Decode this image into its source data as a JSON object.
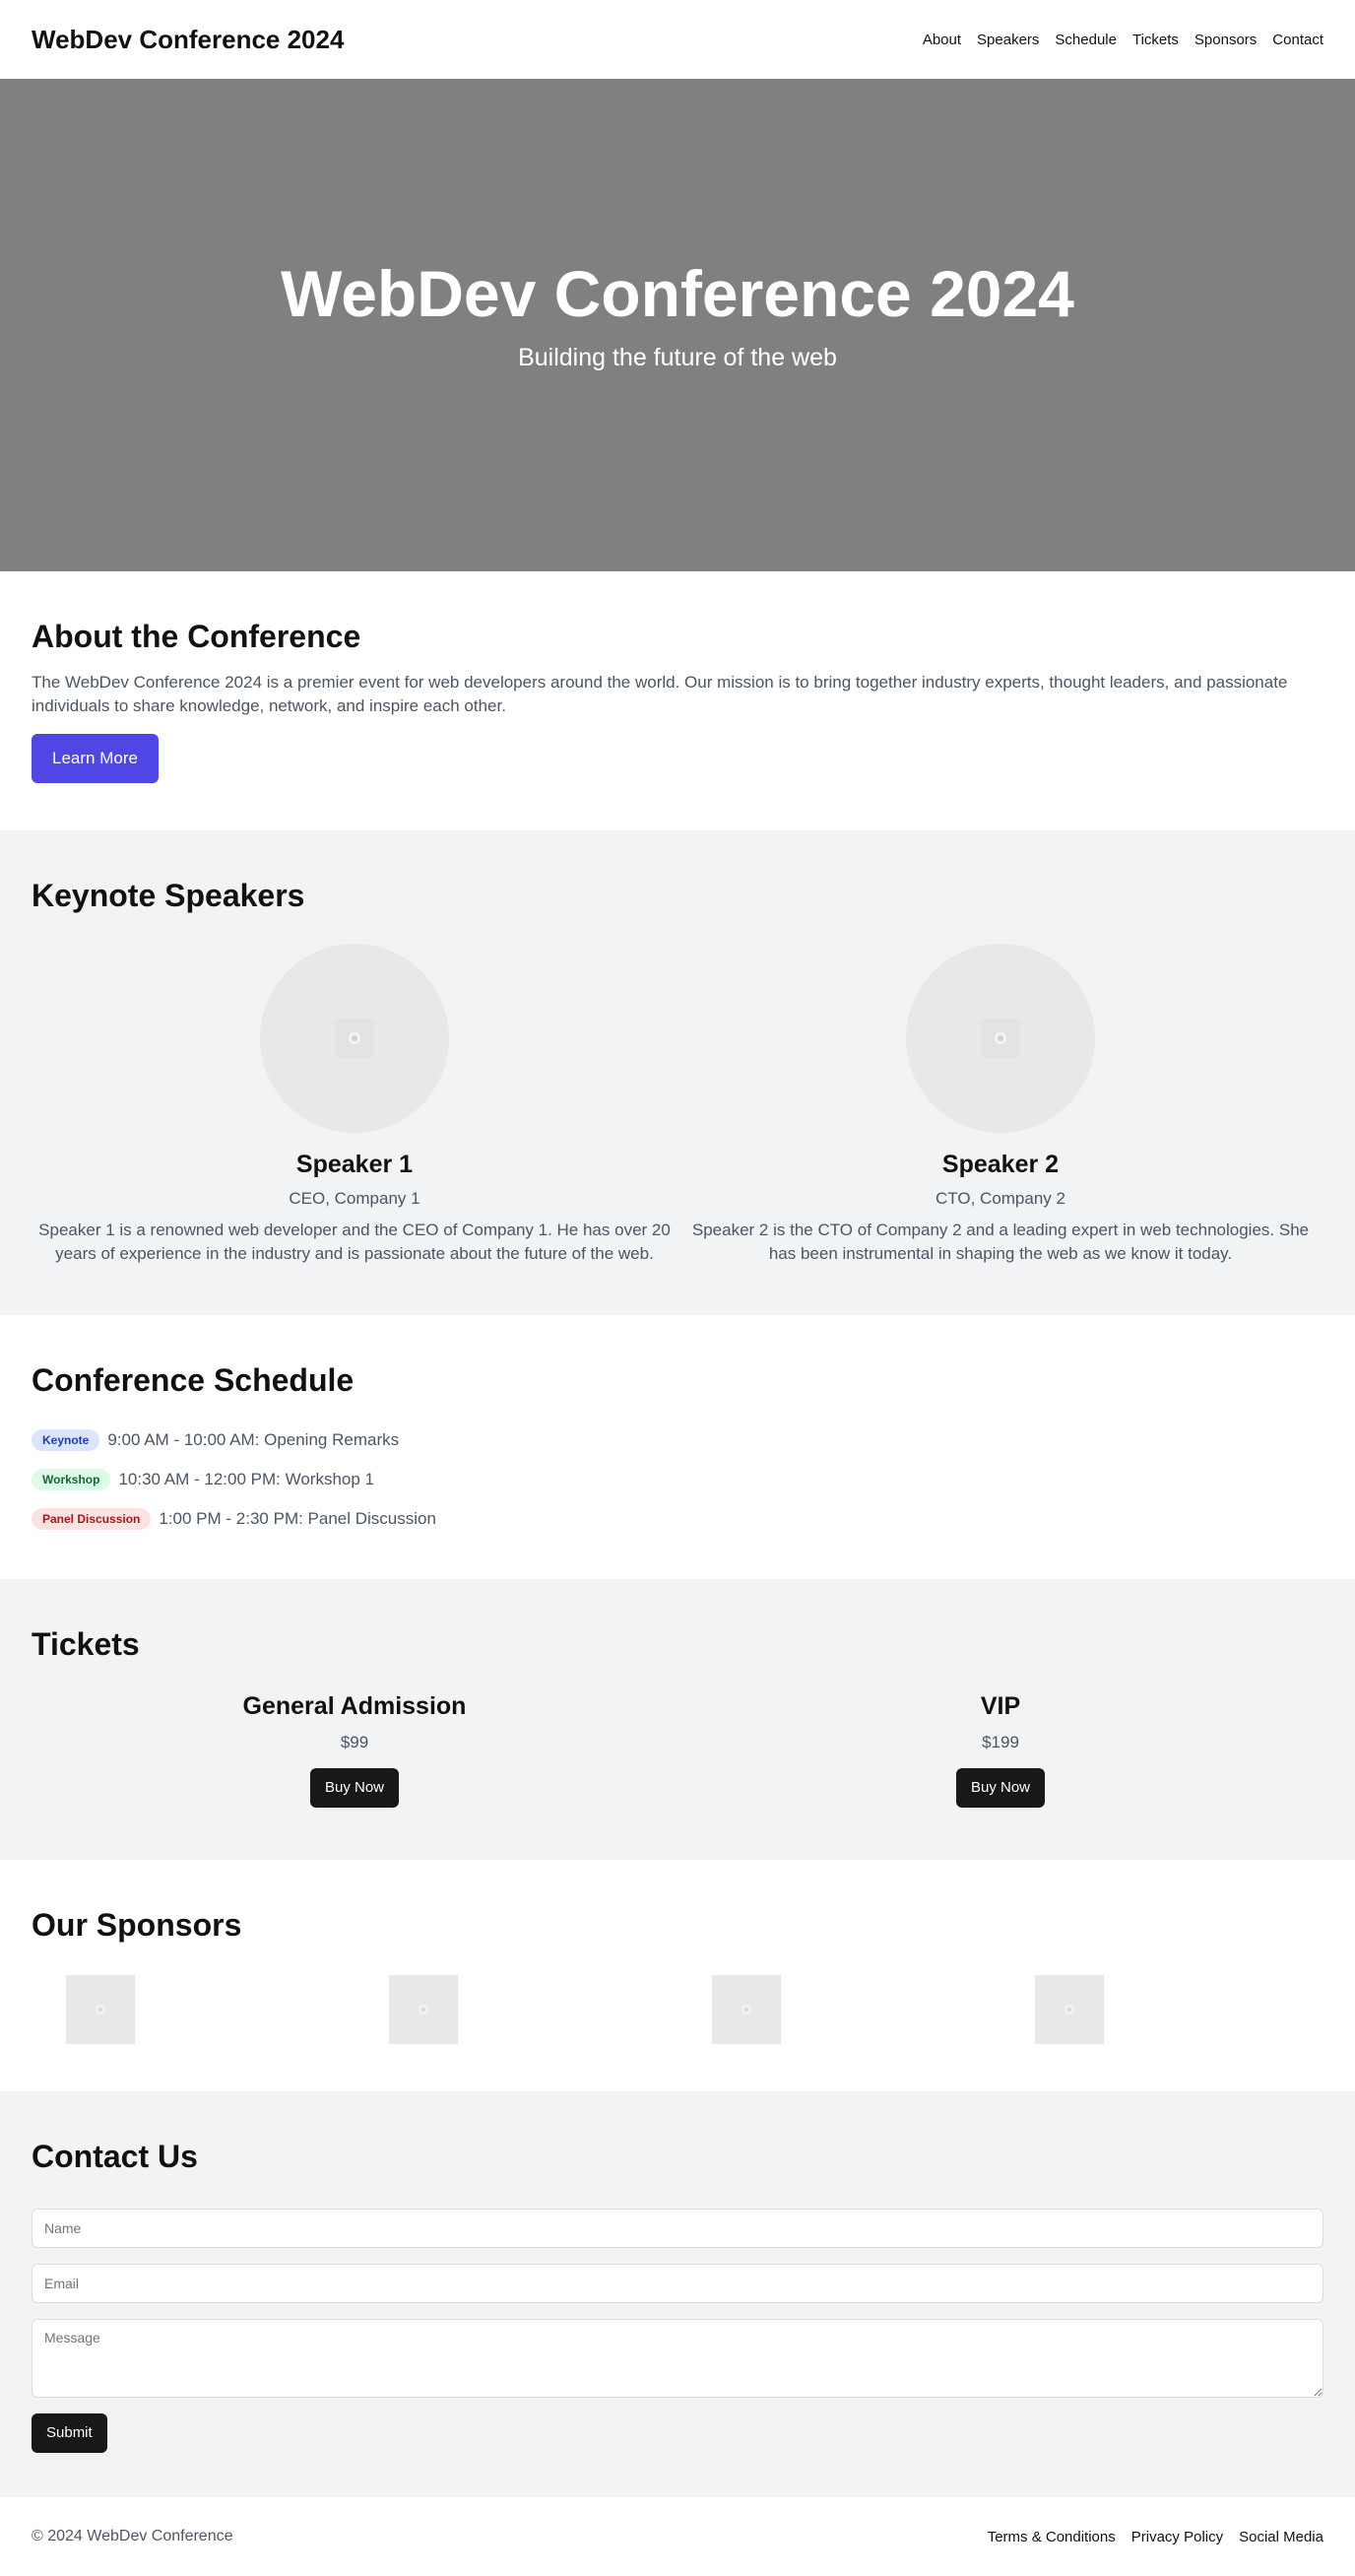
{
  "header": {
    "brand": "WebDev Conference 2024",
    "nav": [
      "About",
      "Speakers",
      "Schedule",
      "Tickets",
      "Sponsors",
      "Contact"
    ]
  },
  "hero": {
    "title": "WebDev Conference 2024",
    "subtitle": "Building the future of the web"
  },
  "about": {
    "heading": "About the Conference",
    "text": "The WebDev Conference 2024 is a premier event for web developers around the world. Our mission is to bring together industry experts, thought leaders, and passionate individuals to share knowledge, network, and inspire each other.",
    "button": "Learn More"
  },
  "speakers": {
    "heading": "Keynote Speakers",
    "items": [
      {
        "name": "Speaker 1",
        "role": "CEO, Company 1",
        "bio": "Speaker 1 is a renowned web developer and the CEO of Company 1. He has over 20 years of experience in the industry and is passionate about the future of the web.",
        "photo_icon": "image-placeholder-icon"
      },
      {
        "name": "Speaker 2",
        "role": "CTO, Company 2",
        "bio": "Speaker 2 is the CTO of Company 2 and a leading expert in web technologies. She has been instrumental in shaping the web as we know it today.",
        "photo_icon": "image-placeholder-icon"
      }
    ]
  },
  "schedule": {
    "heading": "Conference Schedule",
    "items": [
      {
        "badge": "Keynote",
        "text": "9:00 AM - 10:00 AM: Opening Remarks",
        "badge_color": "#1e40af"
      },
      {
        "badge": "Workshop",
        "text": "10:30 AM - 12:00 PM: Workshop 1",
        "badge_color": "#166534"
      },
      {
        "badge": "Panel Discussion",
        "text": "1:00 PM - 2:30 PM: Panel Discussion",
        "badge_color": "#991b1b"
      }
    ]
  },
  "tickets": {
    "heading": "Tickets",
    "items": [
      {
        "name": "General Admission",
        "price": "$99",
        "button": "Buy Now"
      },
      {
        "name": "VIP",
        "price": "$199",
        "button": "Buy Now"
      }
    ]
  },
  "sponsors": {
    "heading": "Our Sponsors",
    "logo_icon": "image-placeholder-icon",
    "count": 4
  },
  "contact": {
    "heading": "Contact Us",
    "name_placeholder": "Name",
    "email_placeholder": "Email",
    "message_placeholder": "Message",
    "submit": "Submit"
  },
  "footer": {
    "copyright": "© 2024 WebDev Conference",
    "links": [
      "Terms & Conditions",
      "Privacy Policy",
      "Social Media"
    ]
  },
  "colors": {
    "accent": "#4f46e5",
    "dark_button": "#18181b",
    "hero_bg": "#808080",
    "section_gray": "#f2f3f5"
  }
}
